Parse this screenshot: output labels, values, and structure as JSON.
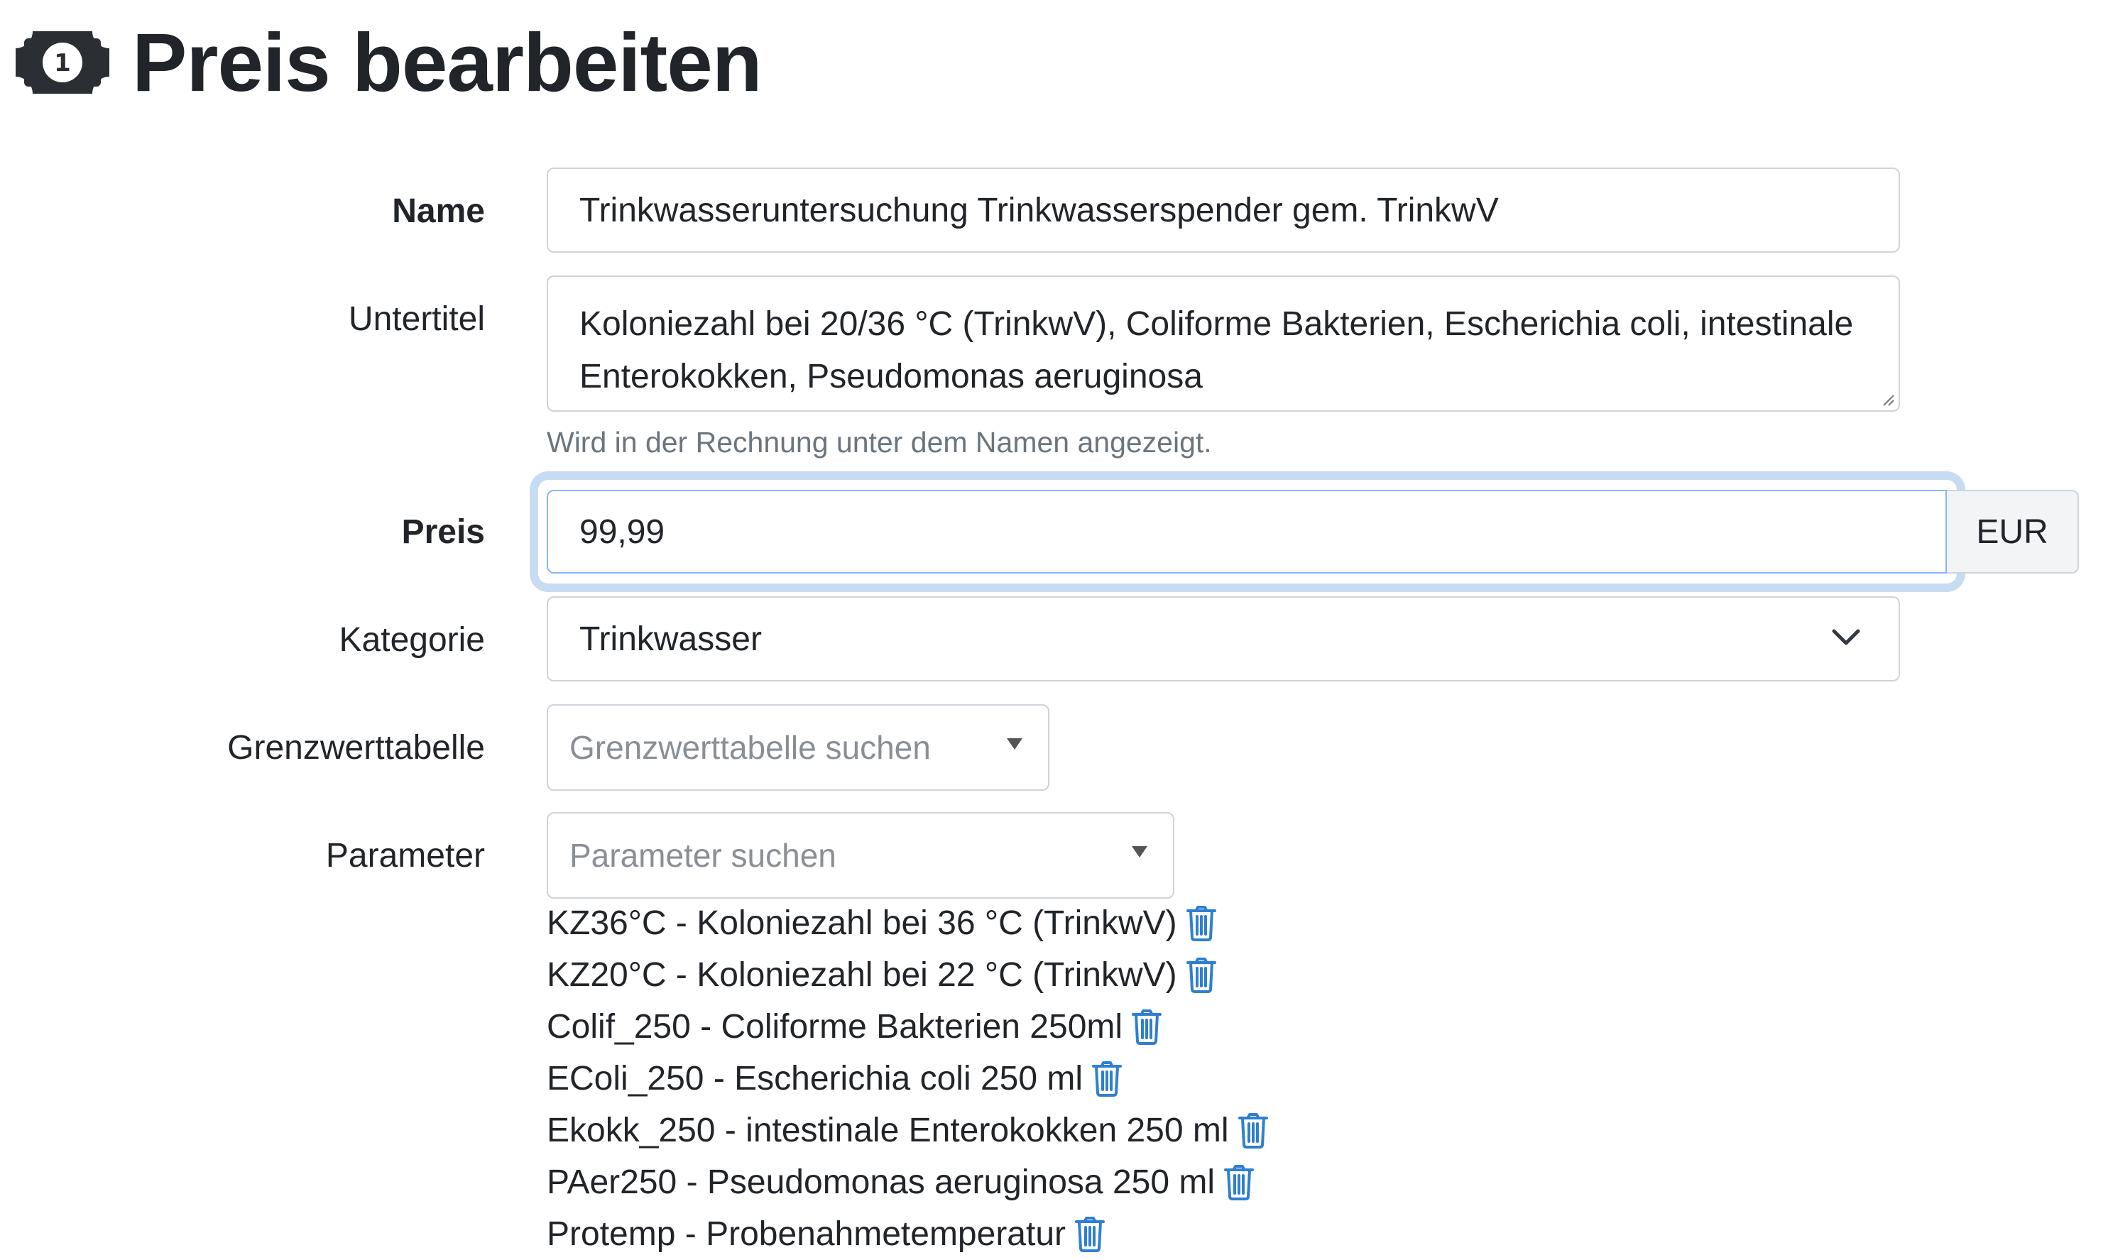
{
  "header": {
    "title": "Preis bearbeiten",
    "icon": "money-bill-icon"
  },
  "form": {
    "name": {
      "label": "Name",
      "value": "Trinkwasseruntersuchung Trinkwasserspender gem. TrinkwV"
    },
    "subtitle": {
      "label": "Untertitel",
      "value": "Koloniezahl bei 20/36 °C (TrinkwV), Coliforme Bakterien, Escherichia coli, intestinale Enterokokken, Pseudomonas aeruginosa",
      "help": "Wird in der Rechnung unter dem Namen angezeigt."
    },
    "price": {
      "label": "Preis",
      "value": "99,99",
      "currency": "EUR"
    },
    "category": {
      "label": "Kategorie",
      "value": "Trinkwasser"
    },
    "limit_table": {
      "label": "Grenzwerttabelle",
      "placeholder": "Grenzwerttabelle suchen"
    },
    "parameters": {
      "label": "Parameter",
      "placeholder": "Parameter suchen",
      "items": [
        {
          "text": "KZ36°C - Koloniezahl bei 36 °C (TrinkwV)"
        },
        {
          "text": "KZ20°C - Koloniezahl bei 22 °C (TrinkwV)"
        },
        {
          "text": "Colif_250 - Coliforme Bakterien 250ml"
        },
        {
          "text": "EColi_250 - Escherichia coli 250 ml"
        },
        {
          "text": "Ekokk_250 - intestinale Enterokokken 250 ml"
        },
        {
          "text": "PAer250 - Pseudomonas aeruginosa 250 ml"
        },
        {
          "text": "Protemp - Probenahmetemperatur"
        }
      ]
    }
  },
  "colors": {
    "text": "#212529",
    "muted": "#6c757d",
    "border": "#ced4da",
    "focus_ring": "#c7dcf2",
    "delete_icon": "#2f7fd1"
  }
}
